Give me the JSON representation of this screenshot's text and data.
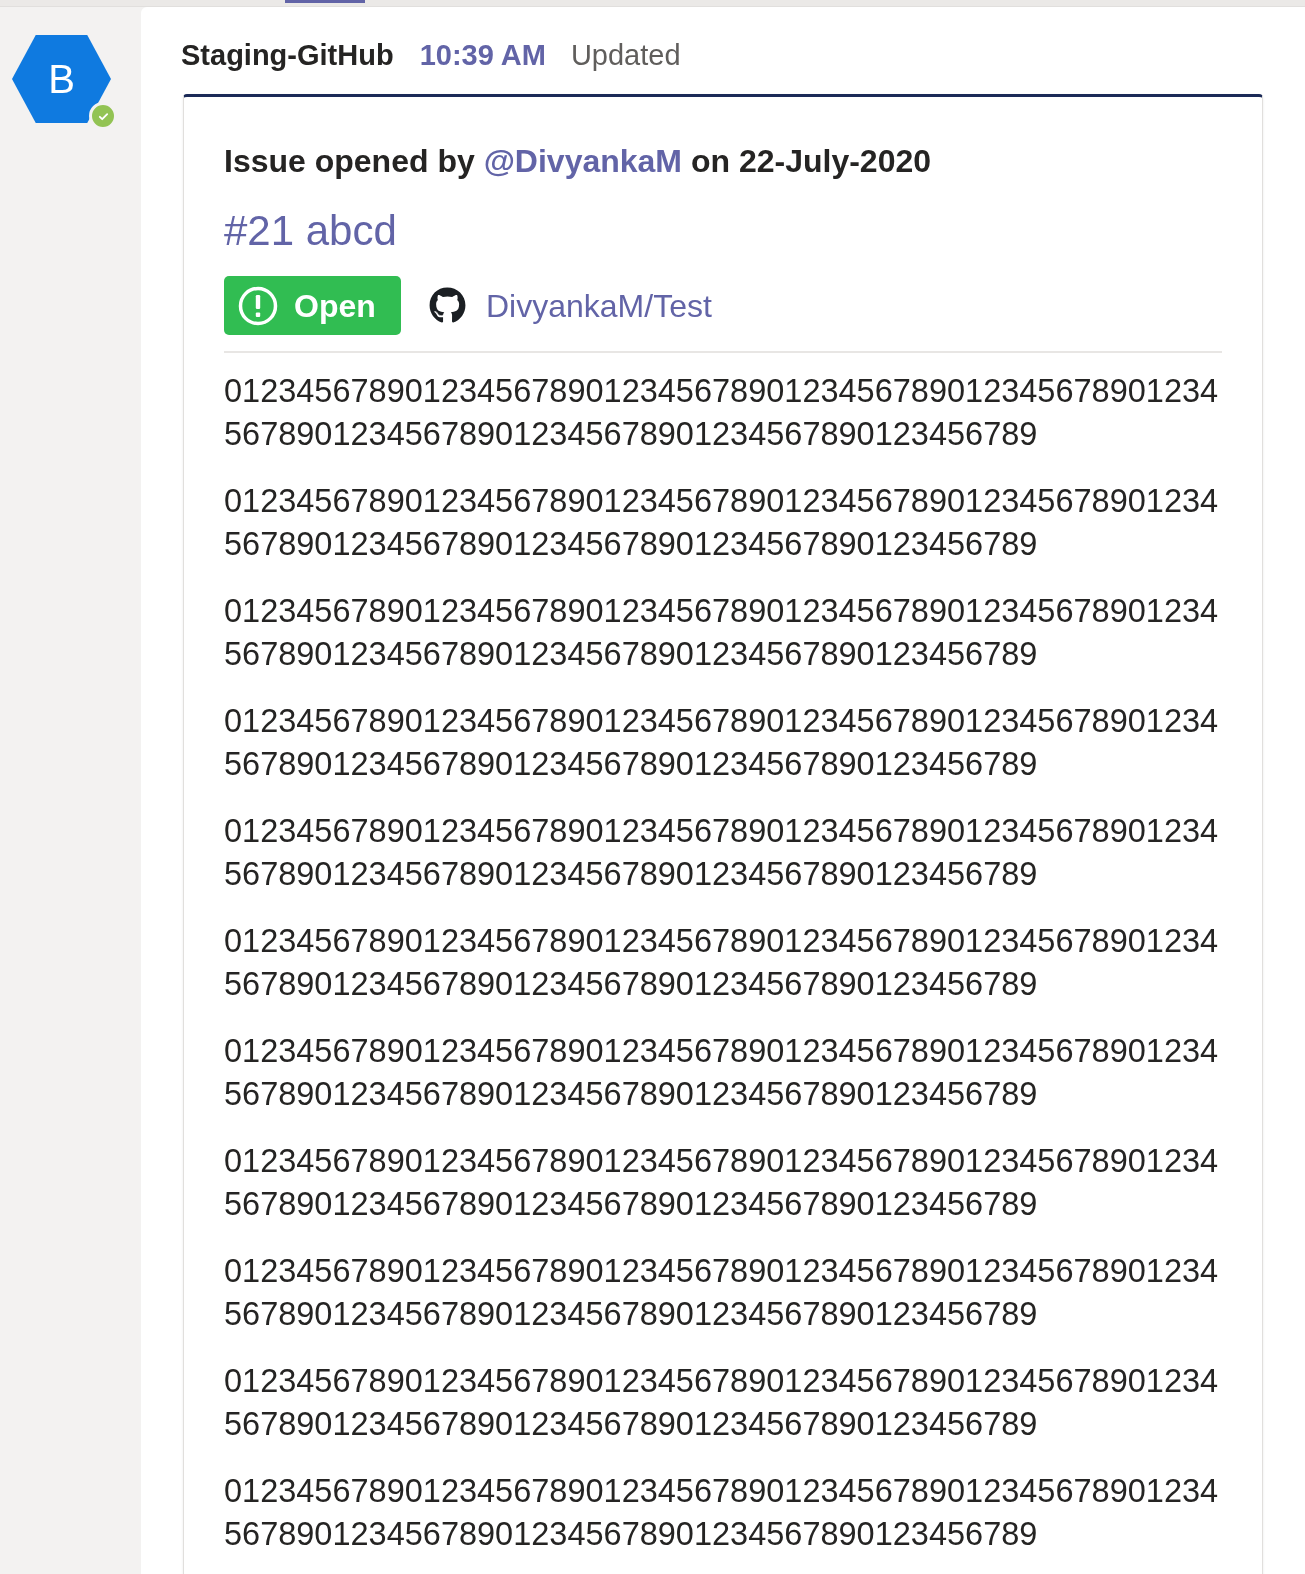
{
  "message": {
    "avatar": {
      "initial": "B",
      "available": true
    },
    "sender": "Staging-GitHub",
    "time": "10:39 AM",
    "note": "Updated"
  },
  "card": {
    "heading": {
      "prefix": "Issue opened by",
      "author": "@DivyankaM",
      "suffix": "on 22-July-2020"
    },
    "title": "#21 abcd",
    "state": {
      "kind": "open",
      "label": "Open"
    },
    "repository": "DivyankaM/Test",
    "paragraphs": [
      "0123456789012345678901234567890123456789012345678901234567890123456789012345678901234567890123456789",
      "0123456789012345678901234567890123456789012345678901234567890123456789012345678901234567890123456789",
      "0123456789012345678901234567890123456789012345678901234567890123456789012345678901234567890123456789",
      "0123456789012345678901234567890123456789012345678901234567890123456789012345678901234567890123456789",
      "0123456789012345678901234567890123456789012345678901234567890123456789012345678901234567890123456789",
      "0123456789012345678901234567890123456789012345678901234567890123456789012345678901234567890123456789",
      "0123456789012345678901234567890123456789012345678901234567890123456789012345678901234567890123456789",
      "0123456789012345678901234567890123456789012345678901234567890123456789012345678901234567890123456789",
      "0123456789012345678901234567890123456789012345678901234567890123456789012345678901234567890123456789",
      "0123456789012345678901234567890123456789012345678901234567890123456789012345678901234567890123456789",
      "0123456789012345678901234567890123456789012345678901234567890123456789012345678901234567890123456789"
    ]
  }
}
